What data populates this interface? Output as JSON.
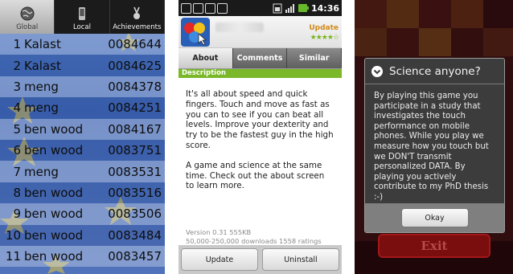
{
  "leaderboard": {
    "tabs": [
      {
        "label": "Global",
        "icon": "globe-icon",
        "selected": true
      },
      {
        "label": "Local",
        "icon": "phone-icon",
        "selected": false
      },
      {
        "label": "Achievements",
        "icon": "trophy-icon",
        "selected": false
      }
    ],
    "rows": [
      {
        "rank": "1",
        "name": "Kalast",
        "score": "0084644"
      },
      {
        "rank": "2",
        "name": "Kalast",
        "score": "0084625"
      },
      {
        "rank": "3",
        "name": "meng",
        "score": "0084378"
      },
      {
        "rank": "4",
        "name": "meng",
        "score": "0084251"
      },
      {
        "rank": "5",
        "name": "ben wood",
        "score": "0084167"
      },
      {
        "rank": "6",
        "name": "ben wood",
        "score": "0083751"
      },
      {
        "rank": "7",
        "name": "meng",
        "score": "0083531"
      },
      {
        "rank": "8",
        "name": "ben wood",
        "score": "0083516"
      },
      {
        "rank": "9",
        "name": "ben wood",
        "score": "0083506"
      },
      {
        "rank": "10",
        "name": "ben wood",
        "score": "0083484"
      },
      {
        "rank": "11",
        "name": "ben wood",
        "score": "0083457"
      }
    ]
  },
  "market": {
    "status_time": "14:36",
    "update_label": "Update",
    "rating": "★★★★☆",
    "tabs": [
      {
        "label": "About",
        "selected": true
      },
      {
        "label": "Comments",
        "selected": false
      },
      {
        "label": "Similar",
        "selected": false
      }
    ],
    "section_title": "Description",
    "description": [
      "It's all about speed and quick fingers. Touch and move as fast as you can to see if you can beat all levels. Improve your dexterity and try to be the fastest guy in the high score.",
      "A game and science at the same time. Check out the about screen to learn more."
    ],
    "version_line": "Version 0.31   555KB",
    "downloads_line": "50,000-250,000 downloads   1558 ratings",
    "buttons": {
      "update": "Update",
      "uninstall": "Uninstall"
    }
  },
  "dialog": {
    "title": "Science anyone?",
    "body": "By playing this game you participate in a study that investigates the touch performance on mobile phones. While you play we measure how you touch but we DON'T transmit personalized DATA. By playing you actively contribute to my PhD thesis :-)",
    "ok_label": "Okay",
    "exit_label": "Exit"
  },
  "colors": {
    "market_accent": "#7ab82a",
    "update_orange": "#d38a19",
    "leaderboard_blue": "#4a74c0"
  }
}
